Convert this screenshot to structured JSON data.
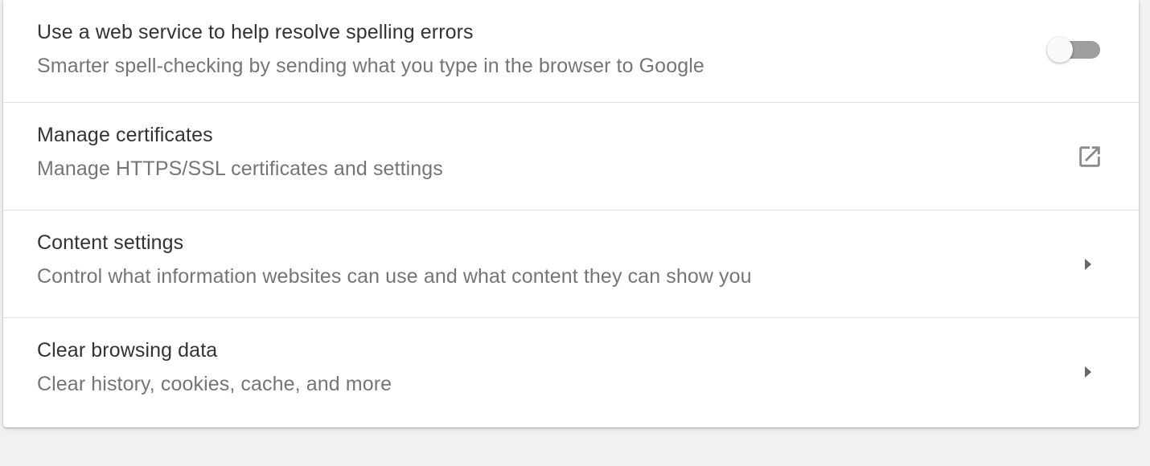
{
  "settings": {
    "rows": [
      {
        "title": "Use a web service to help resolve spelling errors",
        "subtitle": "Smarter spell-checking by sending what you type in the browser to Google",
        "control": "toggle",
        "toggle_state": "off"
      },
      {
        "title": "Manage certificates",
        "subtitle": "Manage HTTPS/SSL certificates and settings",
        "control": "open-in-new-icon"
      },
      {
        "title": "Content settings",
        "subtitle": "Control what information websites can use and what content they can show you",
        "control": "arrow-right-icon"
      },
      {
        "title": "Clear browsing data",
        "subtitle": "Clear history, cookies, cache, and more",
        "control": "arrow-right-icon"
      }
    ]
  },
  "colors": {
    "page_background": "#f1f1f1",
    "card_background": "#ffffff",
    "title_text": "#333333",
    "subtitle_text": "#757575",
    "divider": "#e0e0e0",
    "toggle_track_off": "#9e9e9e",
    "icon": "#8a8a8a"
  }
}
